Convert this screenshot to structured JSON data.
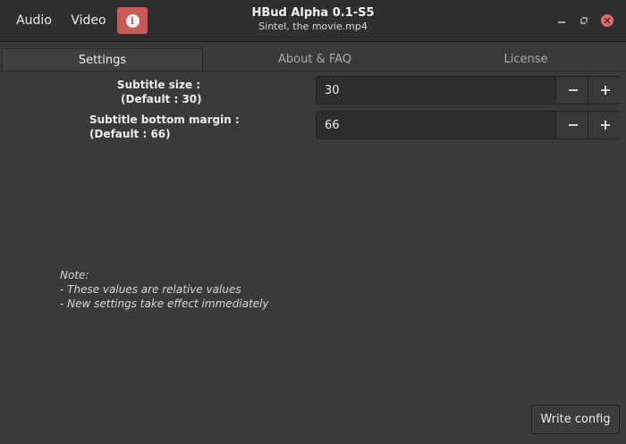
{
  "header": {
    "audio_label": "Audio",
    "video_label": "Video",
    "info_icon": "info-icon",
    "title": "HBud Alpha 0.1-S5",
    "subtitle": "Sintel, the movie.mp4"
  },
  "tabs": [
    {
      "label": "Settings",
      "active": true
    },
    {
      "label": "About & FAQ",
      "active": false
    },
    {
      "label": "License",
      "active": false
    }
  ],
  "settings": {
    "subtitle_size": {
      "label_line1": "Subtitle size :",
      "label_line2": "(Default : 30)",
      "value": "30"
    },
    "subtitle_margin": {
      "label_line1": "Subtitle bottom margin :",
      "label_line2": "(Default : 66)",
      "value": "66"
    },
    "note": {
      "line1": "Note:",
      "line2": "- These values are relative values",
      "line3": "- New settings take effect immediately"
    },
    "write_config_label": "Write config"
  },
  "colors": {
    "background": "#3a3a3a",
    "headerbar": "#2f2f2f",
    "info_button": "#c85a5a",
    "close_button": "#e06b6b"
  }
}
